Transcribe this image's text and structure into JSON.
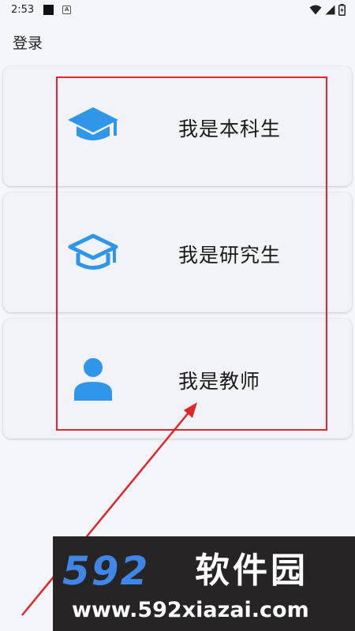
{
  "status_bar": {
    "time": "2:53",
    "icons": [
      "notification-square-icon",
      "a-app-icon",
      "wifi-icon",
      "signal-icon",
      "battery-icon"
    ]
  },
  "page": {
    "title": "登录"
  },
  "roles": [
    {
      "label": "我是本科生",
      "icon": "graduation-cap-filled-icon"
    },
    {
      "label": "我是研究生",
      "icon": "graduation-cap-outline-icon"
    },
    {
      "label": "我是教师",
      "icon": "person-icon"
    }
  ],
  "colors": {
    "accent": "#2f96ea",
    "annotation": "#e0262b",
    "card_bg": "#f2f2f9",
    "page_bg": "#f5f6fc"
  },
  "watermark": {
    "logo": "592",
    "brand": "软件园",
    "url": "www.592xiazai.com"
  }
}
